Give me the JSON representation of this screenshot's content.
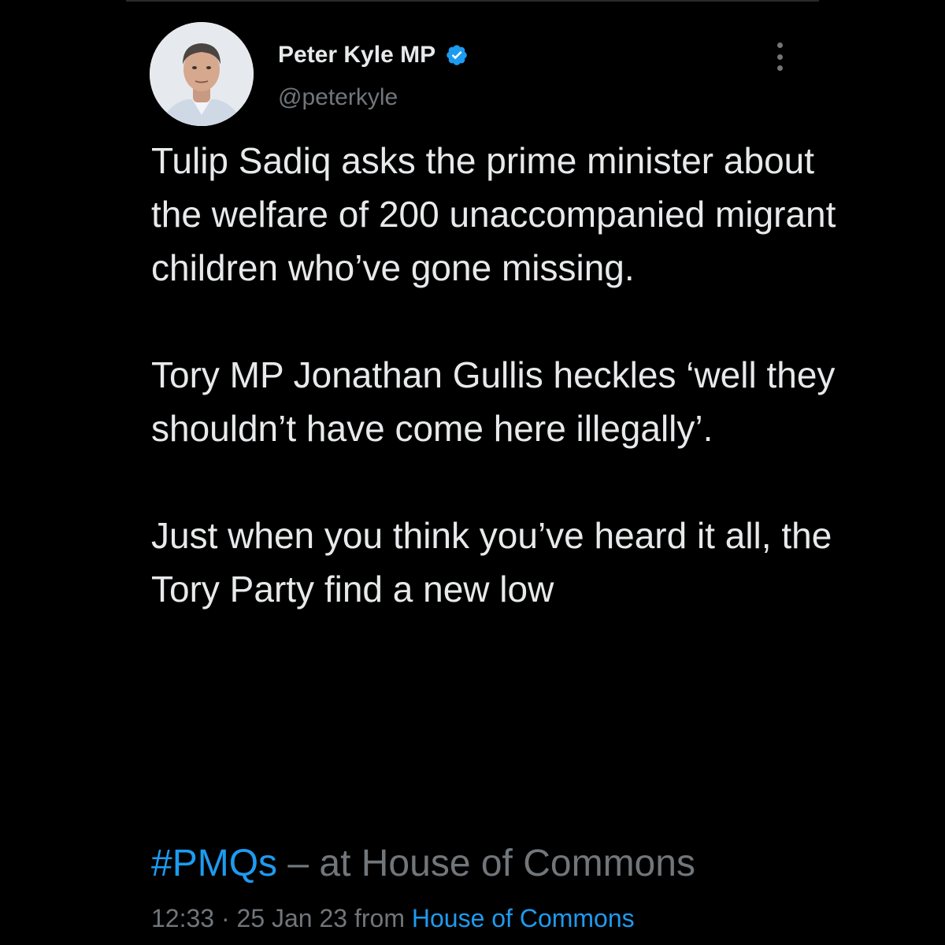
{
  "tweet": {
    "author": {
      "name": "Peter Kyle MP",
      "handle": "@peterkyle",
      "verified": true,
      "verified_color": "#1d9bf0",
      "avatar_icon": "profile-photo"
    },
    "text": "Tulip Sadiq asks the prime minister about the welfare of 200 unaccompanied migrant children who’ve gone missing.\n\nTory MP Jonathan Gullis heckles ‘well they shouldn’t have come here illegally’.\n\nJust when you think you’ve heard it all, the Tory Party find a new low",
    "hashtag": "#PMQs",
    "location_suffix": " – at House of Commons",
    "time": "12:33",
    "separator": " · ",
    "date": "25 Jan 23",
    "from_label": " from ",
    "source": "House of Commons"
  },
  "colors": {
    "background": "#000000",
    "text_primary": "#e7e9ea",
    "text_secondary": "#71767b",
    "accent": "#1d9bf0"
  },
  "icons": {
    "more": "more-options-icon",
    "verified": "verified-badge-icon"
  }
}
